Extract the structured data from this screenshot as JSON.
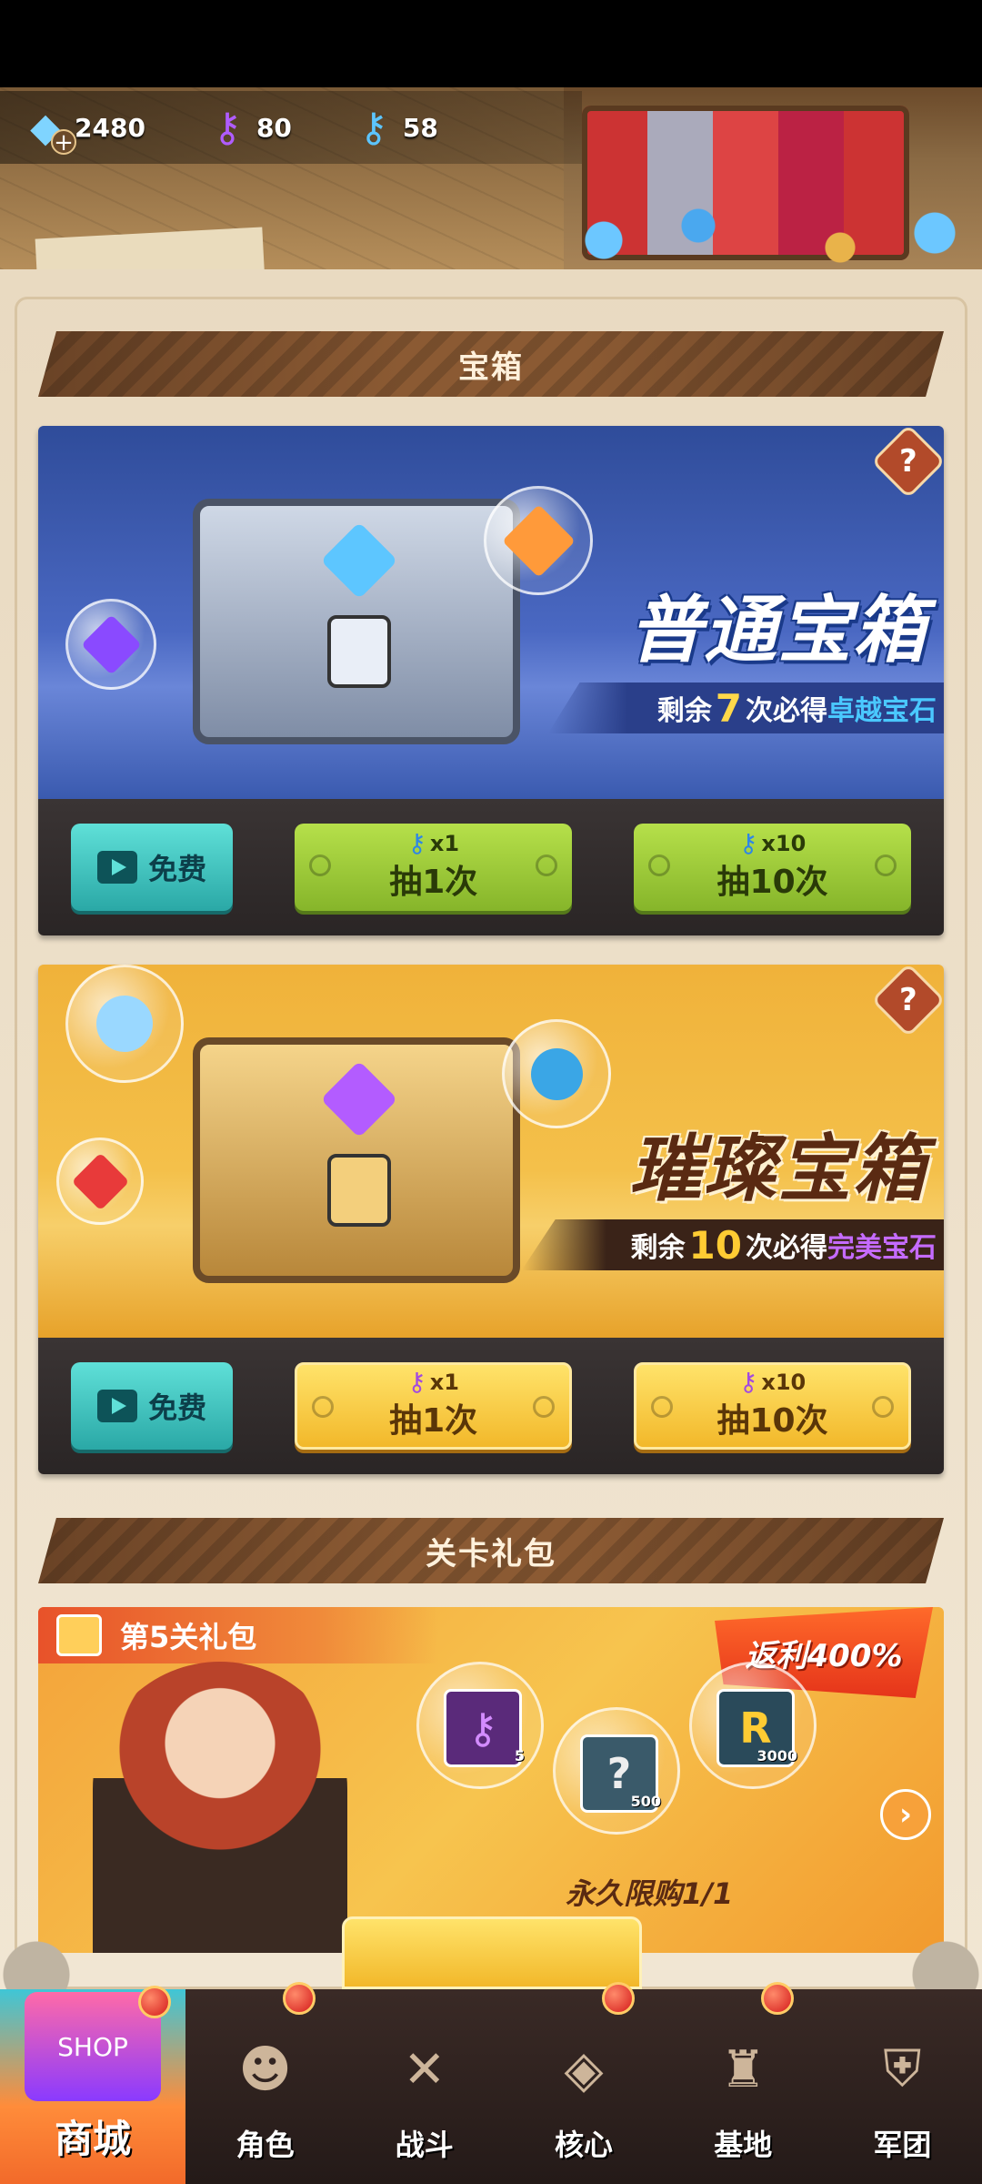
{
  "resources": [
    {
      "name": "diamond",
      "icon": "diamond-icon",
      "value": "2480",
      "color": "#7fd4ff"
    },
    {
      "name": "purple-key",
      "icon": "purple-key-icon",
      "value": "80",
      "color": "#b05cff"
    },
    {
      "name": "blue-key",
      "icon": "blue-key-icon",
      "value": "58",
      "color": "#5cc5ff"
    }
  ],
  "sections": {
    "chests_title": "宝箱",
    "stage_gift_title": "关卡礼包"
  },
  "normal_chest": {
    "title": "普通宝箱",
    "remain_prefix": "剩余",
    "remain_count": "7",
    "remain_mid": "次必得",
    "remain_reward": "卓越宝石",
    "free_label": "免费",
    "draw1_cost": "x1",
    "draw1_label": "抽1次",
    "draw10_cost": "x10",
    "draw10_label": "抽10次"
  },
  "brilliant_chest": {
    "title": "璀璨宝箱",
    "remain_prefix": "剩余",
    "remain_count": "10",
    "remain_mid": "次必得",
    "remain_reward": "完美宝石",
    "free_label": "免费",
    "draw1_cost": "x1",
    "draw1_label": "抽1次",
    "draw10_cost": "x10",
    "draw10_label": "抽10次"
  },
  "stage_gift": {
    "tag": "第5关礼包",
    "rebate": "返利400%",
    "limit": "永久限购1/1",
    "items": [
      {
        "icon": "purple-key-icon",
        "qty": "5"
      },
      {
        "icon": "mystery-scroll-icon",
        "qty": "500"
      },
      {
        "icon": "gold-coin-icon",
        "qty": "3000"
      }
    ]
  },
  "nav": [
    {
      "label": "商城",
      "icon": "shop-icon",
      "active": true
    },
    {
      "label": "角色",
      "icon": "character-icon"
    },
    {
      "label": "战斗",
      "icon": "battle-icon"
    },
    {
      "label": "核心",
      "icon": "core-icon"
    },
    {
      "label": "基地",
      "icon": "base-icon"
    },
    {
      "label": "军团",
      "icon": "legion-icon"
    }
  ],
  "colors": {
    "accent_gold": "#f2b82a",
    "accent_green": "#86b52a",
    "accent_teal": "#2aa8a6",
    "panel_bg": "#efe2cc"
  }
}
